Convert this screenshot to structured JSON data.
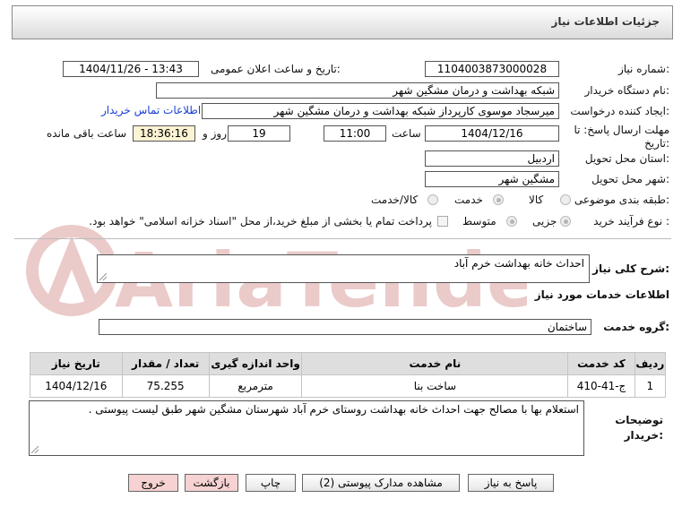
{
  "header": {
    "title": "جزئیات اطلاعات نیاز"
  },
  "fields": {
    "need_number": {
      "label": "شماره نیاز:",
      "value": "1104003873000028"
    },
    "announce_datetime": {
      "label": "تاریخ و ساعت اعلان عمومی:",
      "value": "1404/11/26 - 13:43"
    },
    "buyer_org": {
      "label": "نام دستگاه خریدار:",
      "value": "شبکه بهداشت و درمان مشگین شهر"
    },
    "requester": {
      "label": "ایجاد کننده درخواست:",
      "value": "میرسجاد موسوی کارپرداز شبکه بهداشت و درمان مشگین شهر"
    },
    "contact_link": "اطلاعات تماس خریدار",
    "deadline": {
      "label_line1": "مهلت ارسال پاسخ: تا",
      "label_line2": "تاریخ:",
      "date": "1404/12/16",
      "time_label": "ساعت",
      "time": "11:00",
      "days": "19",
      "days_label": "روز و",
      "remaining": "18:36:16",
      "remaining_label": "ساعت باقی مانده"
    },
    "province": {
      "label": "استان محل تحویل:",
      "value": "اردبیل"
    },
    "city": {
      "label": "شهر محل تحویل:",
      "value": "مشگین شهر"
    },
    "category": {
      "label": "طبقه بندی موضوعی:",
      "options": [
        "کالا",
        "خدمت",
        "کالا/خدمت"
      ],
      "selected": "خدمت"
    },
    "purchase_type": {
      "label": "نوع فرآیند خرید :",
      "options": [
        "جزیی",
        "متوسط"
      ],
      "selected": "جزیی",
      "payment_note": "پرداخت تمام یا بخشی از مبلغ خرید،از محل \"اسناد خزانه اسلامی\" خواهد بود."
    }
  },
  "description": {
    "label": "شرح کلی نیاز:",
    "value": "احداث خانه بهداشت خرم آباد"
  },
  "services_section": {
    "title": "اطلاعات خدمات مورد نیاز",
    "group_label": "گروه خدمت:",
    "group_value": "ساختمان"
  },
  "table": {
    "headers": [
      "ردیف",
      "کد خدمت",
      "نام خدمت",
      "واحد اندازه گیری",
      "تعداد / مقدار",
      "تاریخ نیاز"
    ],
    "rows": [
      [
        "1",
        "ج-41-410",
        "ساخت بنا",
        "مترمربع",
        "75.255",
        "1404/12/16"
      ]
    ]
  },
  "buyer_notes": {
    "label_line1": "توضیحات",
    "label_line2": "خریدار:",
    "value": "استعلام بها با مصالح جهت احداث خانه بهداشت روستای خرم آباد شهرستان مشگین شهر طبق لیست پیوستی ."
  },
  "buttons": {
    "respond": "پاسخ به نیاز",
    "attachments": "مشاهده مدارک پیوستی (2)",
    "print": "چاپ",
    "back": "بازگشت",
    "exit": "خروج"
  },
  "watermark": {
    "text": "AriaTender.net"
  },
  "colors": {
    "link": "#1a3fd6",
    "remaining_bg": "#fbf3d3",
    "watermark": "#e9c2c2"
  }
}
